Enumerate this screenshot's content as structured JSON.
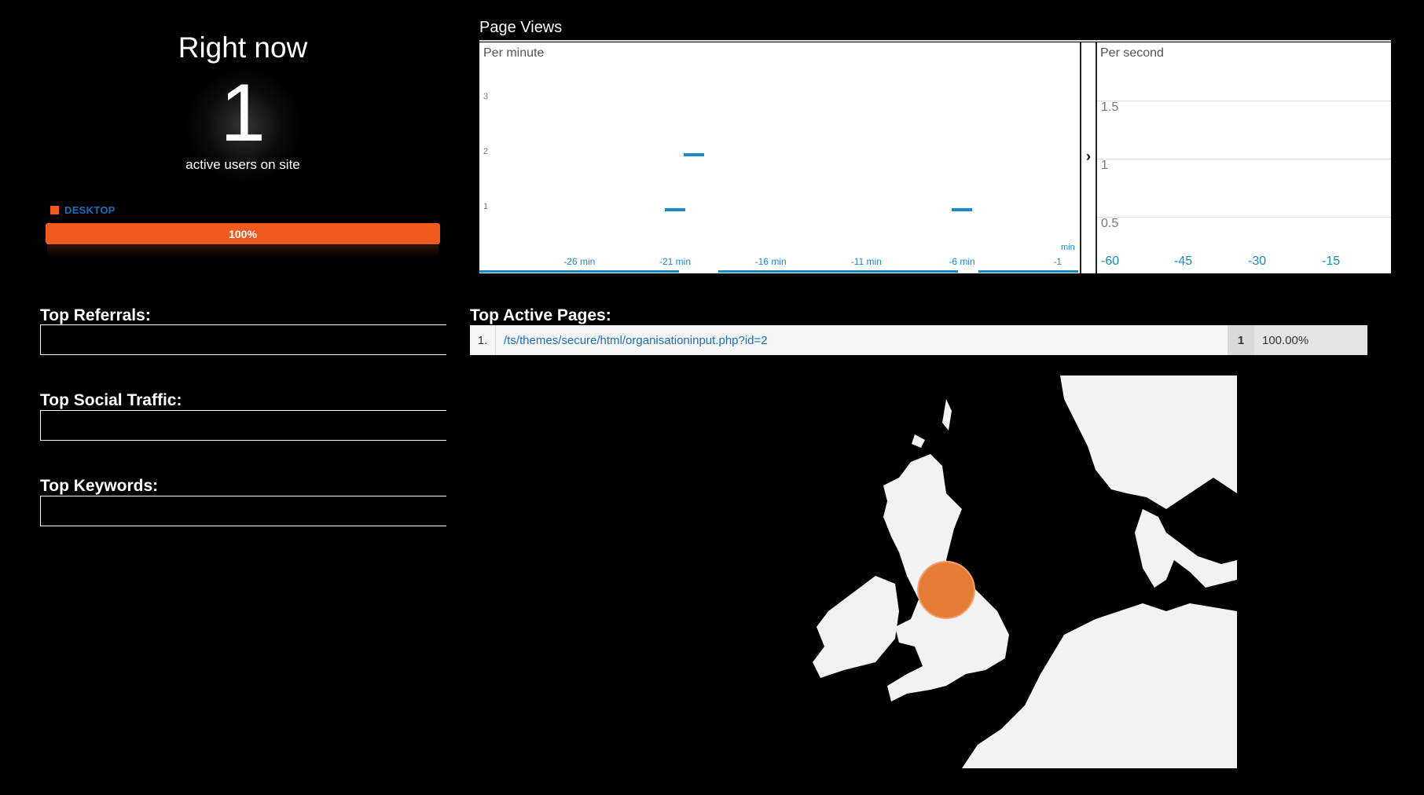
{
  "right_now": {
    "title": "Right now",
    "count": "1",
    "subtitle": "active users on site",
    "device_label": "DESKTOP",
    "device_pct_label": "100%",
    "device_fraction": 1.0,
    "device_color": "#f05a1f"
  },
  "sections": {
    "referrals": "Top Referrals:",
    "social": "Top Social Traffic:",
    "keywords": "Top Keywords:",
    "active_pages": "Top Active Pages:"
  },
  "page_views": {
    "title": "Page Views",
    "per_minute_label": "Per minute",
    "per_second_label": "Per second",
    "expand_glyph": "›"
  },
  "chart_data": [
    {
      "type": "bar",
      "title": "Per minute",
      "x_unit": "min",
      "x_range": [
        -30,
        0
      ],
      "y_range": [
        0,
        3.5
      ],
      "y_ticks": [
        "3",
        "2",
        "1"
      ],
      "x_ticks": [
        "-26 min",
        "-21 min",
        "-16 min",
        "-11 min",
        "-6 min",
        "-1"
      ],
      "series": [
        {
          "values": [
            {
              "x": -21,
              "y": 1
            },
            {
              "x": -20,
              "y": 2
            },
            {
              "x": -6,
              "y": 1
            }
          ]
        }
      ],
      "color": "#1a8ac4"
    },
    {
      "type": "bar",
      "title": "Per second",
      "y_ticks": [
        "1.5",
        "1",
        "0.5"
      ],
      "x_ticks": [
        "-60",
        "-45",
        "-30",
        "-15"
      ],
      "series": []
    }
  ],
  "top_active_pages": [
    {
      "rank": "1.",
      "path": "/ts/themes/secure/html/organisationinput.php?id=2",
      "count": "1",
      "percent": "100.00%"
    }
  ],
  "map": {
    "region": "United Kingdom / North Sea",
    "marker_color": "#e57c35",
    "land_color": "#f2f2f2"
  }
}
